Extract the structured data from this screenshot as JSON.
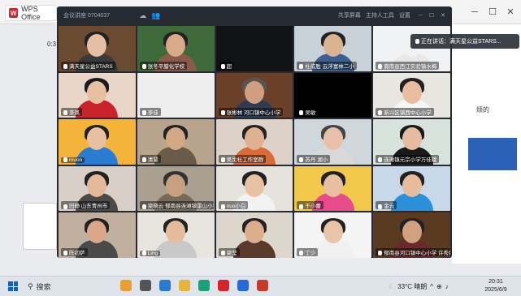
{
  "wps": {
    "tab_label": "WPS Office",
    "logo": "W",
    "min": "─",
    "max": "☐",
    "close": "✕"
  },
  "meeting": {
    "title": "会议讲座 0704037",
    "toolbar": {
      "share": "共享屏幕",
      "assist": "主持人工具",
      "settings": "设置"
    },
    "speaking_label": "正在讲话：满天星公益STARS...",
    "participants": [
      {
        "name": "满天星公益STARS",
        "bg": "#6b4a32",
        "shirt": "#3a3a3a",
        "face": "#e4bfa3",
        "hair": "#222"
      },
      {
        "name": "张冬平腊化学校",
        "bg": "#3f6b3a",
        "shirt": "#8a5a4a",
        "face": "#d8aa88",
        "hair": "#222"
      },
      {
        "name": "超",
        "bg": "#101214",
        "shirt": "#101214",
        "face": "#101214",
        "hair": "#101214"
      },
      {
        "name": "杜成胜 云浮富林二小",
        "bg": "#c8d0d8",
        "shirt": "#3b5f8e",
        "face": "#d9b28f",
        "hair": "#222"
      },
      {
        "name": "蓉南县西江实验镇水梅",
        "bg": "#f0f2f4",
        "shirt": "#e8e8e8",
        "face": "#f0f2f4",
        "hair": "#f0f2f4"
      },
      {
        "name": "李凤",
        "bg": "#e8d6c8",
        "shirt": "#c9242b",
        "face": "#e6c0a0",
        "hair": "#1a1a1a"
      },
      {
        "name": "李佳",
        "bg": "#eee",
        "shirt": "#eee",
        "face": "#eee",
        "hair": "#eee"
      },
      {
        "name": "张彬林 河口镇中心小学",
        "bg": "#6a4028",
        "shirt": "#2f3b50",
        "face": "#cf9f80",
        "hair": "#555"
      },
      {
        "name": "吴敏",
        "bg": "#000",
        "shirt": "#000",
        "face": "#000",
        "hair": "#000"
      },
      {
        "name": "新兴区镇西中心小学",
        "bg": "#e8e6e0",
        "shirt": "#f5f5f5",
        "face": "#e8bca0",
        "hair": "#222"
      },
      {
        "name": "muon",
        "bg": "#f4b43a",
        "shirt": "#2b7bd0",
        "face": "#e8c0a0",
        "hair": "#222"
      },
      {
        "name": "清慧",
        "bg": "#b8a48c",
        "shirt": "#6a5a4a",
        "face": "#d4a884",
        "hair": "#222"
      },
      {
        "name": "吴生杜工作室群",
        "bg": "#dcd2c8",
        "shirt": "#d96a3a",
        "face": "#e0b090",
        "hair": "#222"
      },
      {
        "name": "苏丹 湖小",
        "bg": "#cfd6dc",
        "shirt": "#d8d8d8",
        "face": "#e8c0a8",
        "hair": "#444"
      },
      {
        "name": "连滩镇元宗小学万佳娥",
        "bg": "#d8e2dc",
        "shirt": "#1a1a1a",
        "face": "#e6bca0",
        "hair": "#1a1a1a"
      },
      {
        "name": "田静 山东青州市",
        "bg": "#d8d0c8",
        "shirt": "#4a4a4a",
        "face": "#e4b898",
        "hair": "#222"
      },
      {
        "name": "梁晓云 郁南县连滩镇雷山小学",
        "bg": "#aaa090",
        "shirt": "#7a6a5a",
        "face": "#c8a080",
        "hair": "#333"
      },
      {
        "name": "nuo小白",
        "bg": "#e6e2dc",
        "shirt": "#f2f2f2",
        "face": "#e8c0a4",
        "hair": "#222"
      },
      {
        "name": "千小蕾",
        "bg": "#f2c84a",
        "shirt": "#e84a8a",
        "face": "#e8c0a0",
        "hair": "#222"
      },
      {
        "name": "金云",
        "bg": "#c8d8e8",
        "shirt": "#2a90d8",
        "face": "#e6bc9c",
        "hair": "#222"
      },
      {
        "name": "陈初萨",
        "bg": "#c0b0a0",
        "shirt": "#4a4a4a",
        "face": "#d8a888",
        "hair": "#222"
      },
      {
        "name": "Ling",
        "bg": "#e8e4de",
        "shirt": "#c8c8c8",
        "face": "#e4bc9c",
        "hair": "#222"
      },
      {
        "name": "梁莹",
        "bg": "#ddd6cc",
        "shirt": "#5a3a2a",
        "face": "#dcae8c",
        "hair": "#222"
      },
      {
        "name": "丁少",
        "bg": "#f4f4f4",
        "shirt": "#f0f0f0",
        "face": "#e8c4a8",
        "hair": "#222"
      },
      {
        "name": "郁南县河口镇中心小学 许秀娟",
        "bg": "#5a3a20",
        "shirt": "#6a2a2a",
        "face": "#d0a080",
        "hair": "#222"
      }
    ]
  },
  "taskbar": {
    "search_placeholder": "搜索",
    "weather": "33°C 晴朗",
    "time": "20:31",
    "date": "2025/6/9",
    "icons": [
      {
        "name": "widgets-icon",
        "color": "#e8a030"
      },
      {
        "name": "taskview-icon",
        "color": "#555"
      },
      {
        "name": "store-icon",
        "color": "#2b7bd0"
      },
      {
        "name": "file-explorer-icon",
        "color": "#e6b43a"
      },
      {
        "name": "edge-icon",
        "color": "#1aa07a"
      },
      {
        "name": "wps-icon",
        "color": "#d7242a"
      },
      {
        "name": "meeting-icon",
        "color": "#2a6ad8"
      },
      {
        "name": "wps-doc-icon",
        "color": "#c83a2a"
      }
    ]
  },
  "side_text": {
    "right_snippet": "烦的",
    "left_time": "0:3"
  }
}
